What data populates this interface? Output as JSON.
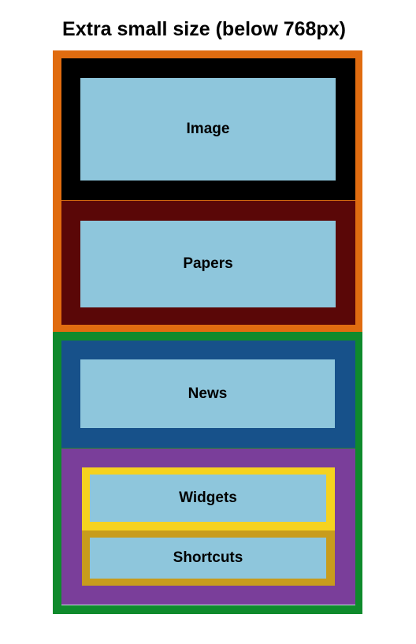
{
  "title": "Extra small size (below 768px)",
  "regions": {
    "image": {
      "label": "Image"
    },
    "papers": {
      "label": "Papers"
    },
    "news": {
      "label": "News"
    },
    "widgets": {
      "label": "Widgets"
    },
    "shortcuts": {
      "label": "Shortcuts"
    }
  },
  "colors": {
    "top_group_border": "#e06c10",
    "image_container": "#000000",
    "papers_container": "#5a0707",
    "bottom_group_border": "#0f8a2c",
    "news_container": "#17518a",
    "sidebar_container": "#7a3e9a",
    "widgets_border": "#f5d21f",
    "shortcuts_border": "#c89c1c",
    "content_fill": "#8ec6dc"
  }
}
